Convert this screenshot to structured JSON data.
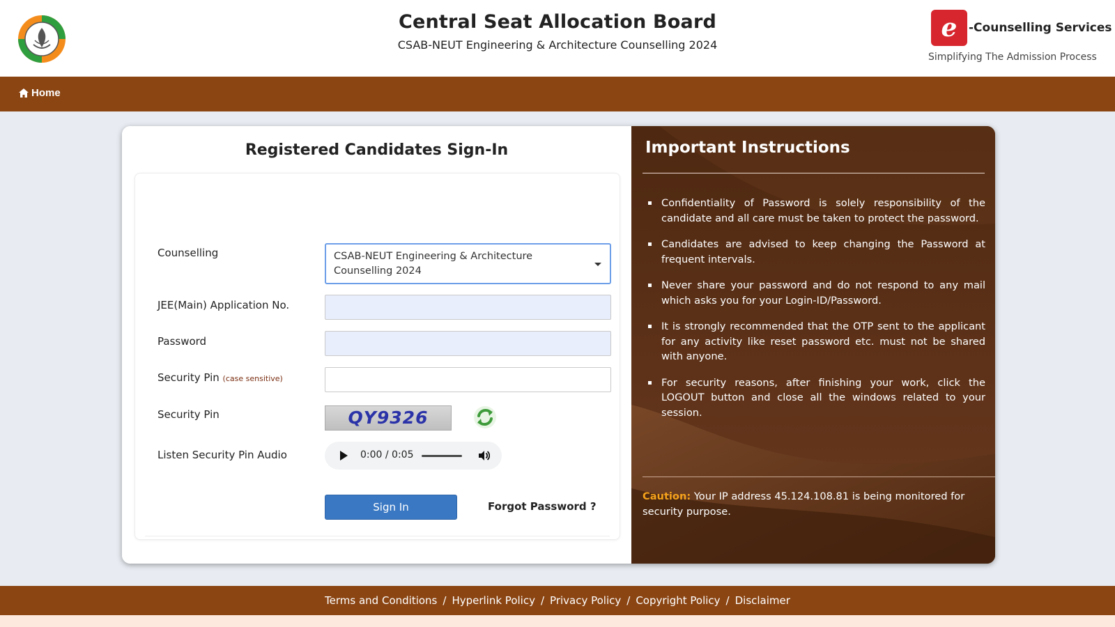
{
  "header": {
    "title": "Central Seat Allocation Board",
    "subtitle": "CSAB-NEUT Engineering & Architecture Counselling 2024",
    "brand": {
      "mark": "e",
      "name": "-Counselling Services",
      "tagline": "Simplifying The Admission Process"
    },
    "icons": {
      "left_logo": "emblem-logo",
      "right_logo": "e-counselling-logo"
    }
  },
  "nav": {
    "home_label": "Home",
    "home_icon": "home-icon"
  },
  "signin": {
    "title": "Registered Candidates Sign-In",
    "counselling": {
      "label": "Counselling",
      "selected_line1": "CSAB-NEUT Engineering & Architecture",
      "selected_line2": "Counselling 2024"
    },
    "application_no": {
      "label": "JEE(Main) Application No.",
      "value": "",
      "placeholder": ""
    },
    "password": {
      "label": "Password",
      "value": "",
      "placeholder": ""
    },
    "security_pin_input": {
      "label": "Security Pin",
      "note": "(case sensitive)",
      "value": "",
      "placeholder": ""
    },
    "security_pin_captcha": {
      "label": "Security Pin",
      "code": "QY9326"
    },
    "audio": {
      "label": "Listen Security Pin Audio",
      "time": "0:00 / 0:05"
    },
    "buttons": {
      "sign_in": "Sign In",
      "forgot": "Forgot Password ?"
    }
  },
  "instructions": {
    "title": "Important Instructions",
    "items": [
      "Confidentiality of Password is solely responsibility of the candidate and all care must be taken to protect the password.",
      "Candidates are advised to keep changing the Password at frequent intervals.",
      "Never share your password and do not respond to any mail which asks you for your Login-ID/Password.",
      "It is strongly recommended that the OTP sent to the applicant for any activity like reset password etc. must not be shared with anyone.",
      "For security reasons, after finishing your work, click the LOGOUT button and close all the windows related to your session."
    ],
    "caution_label": "Caution:",
    "caution_text": " Your IP address 45.124.108.81 is being monitored for security purpose."
  },
  "footer": {
    "links": [
      "Terms and Conditions",
      "Hyperlink Policy",
      "Privacy Policy",
      "Copyright Policy",
      "Disclaimer"
    ],
    "separator": "/"
  },
  "colors": {
    "nav_brown": "#8b4513",
    "panel_brown": "#5a2f16",
    "primary_button": "#3a78c3",
    "caution_orange": "#f5a21b",
    "brand_red": "#d7262e"
  }
}
